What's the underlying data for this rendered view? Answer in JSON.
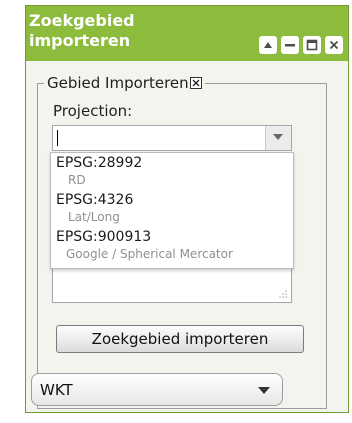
{
  "window": {
    "title_line1": "Zoekgebied",
    "title_line2": "importeren",
    "header_buttons": [
      "expand-icon",
      "minimize-icon",
      "restore-icon",
      "close-icon"
    ]
  },
  "fieldset": {
    "legend": "Gebied Importeren"
  },
  "projection": {
    "label": "Projection:",
    "value": "",
    "options": [
      {
        "code": "EPSG:28992",
        "desc": "RD"
      },
      {
        "code": "EPSG:4326",
        "desc": "Lat/Long"
      },
      {
        "code": "EPSG:900913",
        "desc": "Google / Spherical Mercator"
      }
    ]
  },
  "import_button": "Zoekgebied importeren",
  "format_select": {
    "value": "WKT"
  },
  "colors": {
    "header": "#8dbb3c",
    "border": "#6f9a2e"
  }
}
